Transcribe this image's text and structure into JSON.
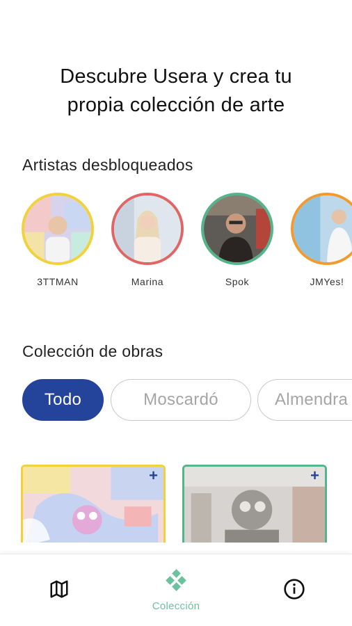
{
  "headline": {
    "line1": "Descubre Usera y crea tu",
    "line2": "propia colección de arte"
  },
  "artists_section": {
    "title": "Artistas desbloqueados",
    "artists": [
      {
        "name": "3TTMAN",
        "ring_color": "#f1d23b"
      },
      {
        "name": "Marina",
        "ring_color": "#e06666"
      },
      {
        "name": "Spok",
        "ring_color": "#56b48a"
      },
      {
        "name": "JMYes!",
        "ring_color": "#f29a2e"
      }
    ]
  },
  "works_section": {
    "title": "Colección de obras",
    "filters": [
      {
        "label": "Todo",
        "selected": true
      },
      {
        "label": "Moscardó",
        "selected": false
      },
      {
        "label": "Almendra",
        "selected": false
      }
    ],
    "cards": [
      {
        "border_color": "#f1d23b",
        "action": "+"
      },
      {
        "border_color": "#56b48a",
        "action": "+"
      }
    ]
  },
  "bottom_nav": {
    "items": [
      {
        "icon": "map-icon",
        "label": ""
      },
      {
        "icon": "collection-icon",
        "label": "Colección",
        "active": true
      },
      {
        "icon": "info-icon",
        "label": ""
      }
    ]
  },
  "colors": {
    "accent_blue": "#24439a",
    "accent_green": "#6cc19f"
  }
}
